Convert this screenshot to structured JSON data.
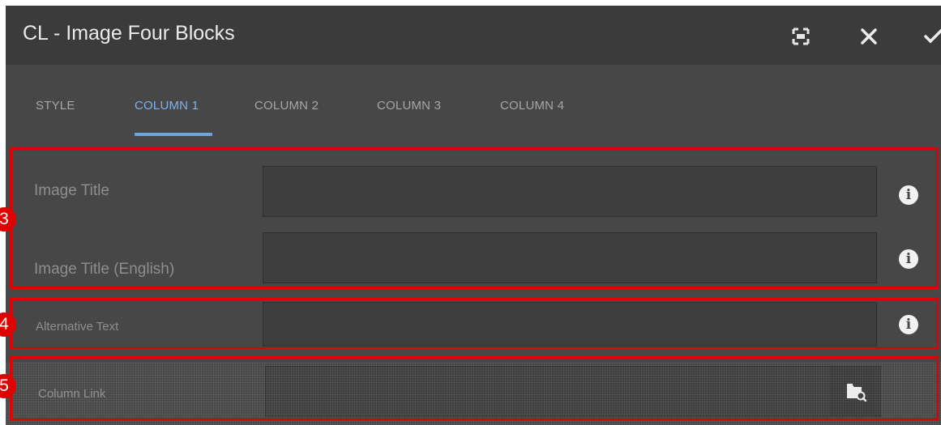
{
  "dialog": {
    "title": "CL - Image Four Blocks",
    "buttons": {
      "fullscreen": "fullscreen-icon",
      "close": "close-icon",
      "done": "check-icon"
    }
  },
  "tabs": [
    {
      "label": "STYLE",
      "active": false
    },
    {
      "label": "COLUMN 1",
      "active": true
    },
    {
      "label": "COLUMN 2",
      "active": false
    },
    {
      "label": "COLUMN 3",
      "active": false
    },
    {
      "label": "COLUMN 4",
      "active": false
    }
  ],
  "fields": {
    "image_title": {
      "label": "Image Title",
      "value": ""
    },
    "image_title_english": {
      "label": "Image Title (English)",
      "value": ""
    },
    "alternative_text": {
      "label": "Alternative Text",
      "value": ""
    },
    "column_link": {
      "label": "Column Link",
      "value": ""
    }
  },
  "annotations": {
    "a3": "3",
    "a4": "4",
    "a5": "5"
  },
  "colors": {
    "accent": "#6aa7e8",
    "highlight": "#e00000",
    "background": "#474747"
  }
}
